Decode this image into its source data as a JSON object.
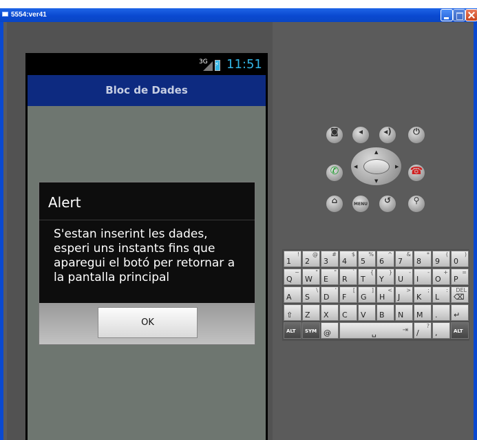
{
  "window": {
    "title": "5554:ver41"
  },
  "status_bar": {
    "network": "3G",
    "clock": "11:51"
  },
  "app": {
    "title": "Bloc de Dades"
  },
  "dialog": {
    "title": "Alert",
    "message_lines": [
      "S'estan inserint les dades,",
      "esperi uns instants fins que",
      "aparegui el botó per retornar a",
      "la pantalla principal"
    ],
    "ok_label": "OK"
  },
  "hardware_buttons": {
    "camera": "camera-icon",
    "volume_down": "volume-down-icon",
    "volume_up": "volume-up-icon",
    "power": "power-icon",
    "call": "call-icon",
    "end_call": "end-call-icon",
    "home": "home-icon",
    "menu_label": "MENU",
    "back": "back-icon",
    "search": "search-icon"
  },
  "keyboard": {
    "row1": [
      {
        "main": "1",
        "alt": "!"
      },
      {
        "main": "2",
        "alt": "@"
      },
      {
        "main": "3",
        "alt": "#"
      },
      {
        "main": "4",
        "alt": "$"
      },
      {
        "main": "5",
        "alt": "%"
      },
      {
        "main": "6",
        "alt": "^"
      },
      {
        "main": "7",
        "alt": "&"
      },
      {
        "main": "8",
        "alt": "*"
      },
      {
        "main": "9",
        "alt": "("
      },
      {
        "main": "0",
        "alt": ")"
      }
    ],
    "row2": [
      {
        "main": "Q",
        "alt": "~"
      },
      {
        "main": "W",
        "alt": "\""
      },
      {
        "main": "E",
        "alt": "\""
      },
      {
        "main": "R",
        "alt": "`"
      },
      {
        "main": "T",
        "alt": "{"
      },
      {
        "main": "Y",
        "alt": "}"
      },
      {
        "main": "U",
        "alt": "-"
      },
      {
        "main": "I",
        "alt": "-"
      },
      {
        "main": "O",
        "alt": "+"
      },
      {
        "main": "P",
        "alt": "="
      }
    ],
    "row3": [
      {
        "main": "A",
        "alt": ""
      },
      {
        "main": "S",
        "alt": "\\"
      },
      {
        "main": "D",
        "alt": "'"
      },
      {
        "main": "F",
        "alt": "["
      },
      {
        "main": "G",
        "alt": "]"
      },
      {
        "main": "H",
        "alt": "<"
      },
      {
        "main": "J",
        "alt": ">"
      },
      {
        "main": "K",
        "alt": ";"
      },
      {
        "main": "L",
        "alt": ":"
      },
      {
        "main": "⌫",
        "alt": "DEL"
      }
    ],
    "row4": [
      {
        "main": "⇧",
        "alt": ""
      },
      {
        "main": "Z",
        "alt": ""
      },
      {
        "main": "X",
        "alt": ""
      },
      {
        "main": "C",
        "alt": ""
      },
      {
        "main": "V",
        "alt": ""
      },
      {
        "main": "B",
        "alt": ""
      },
      {
        "main": "N",
        "alt": ""
      },
      {
        "main": "M",
        "alt": ""
      },
      {
        "main": ".",
        "alt": ""
      },
      {
        "main": "↵",
        "alt": ""
      }
    ],
    "row5": {
      "alt_left": "ALT",
      "sym": "SYM",
      "at": "@",
      "space": "␣",
      "tab": "⇥",
      "slash": "/",
      "slash_alt": "?",
      "comma": ",",
      "alt_right": "ALT"
    }
  }
}
